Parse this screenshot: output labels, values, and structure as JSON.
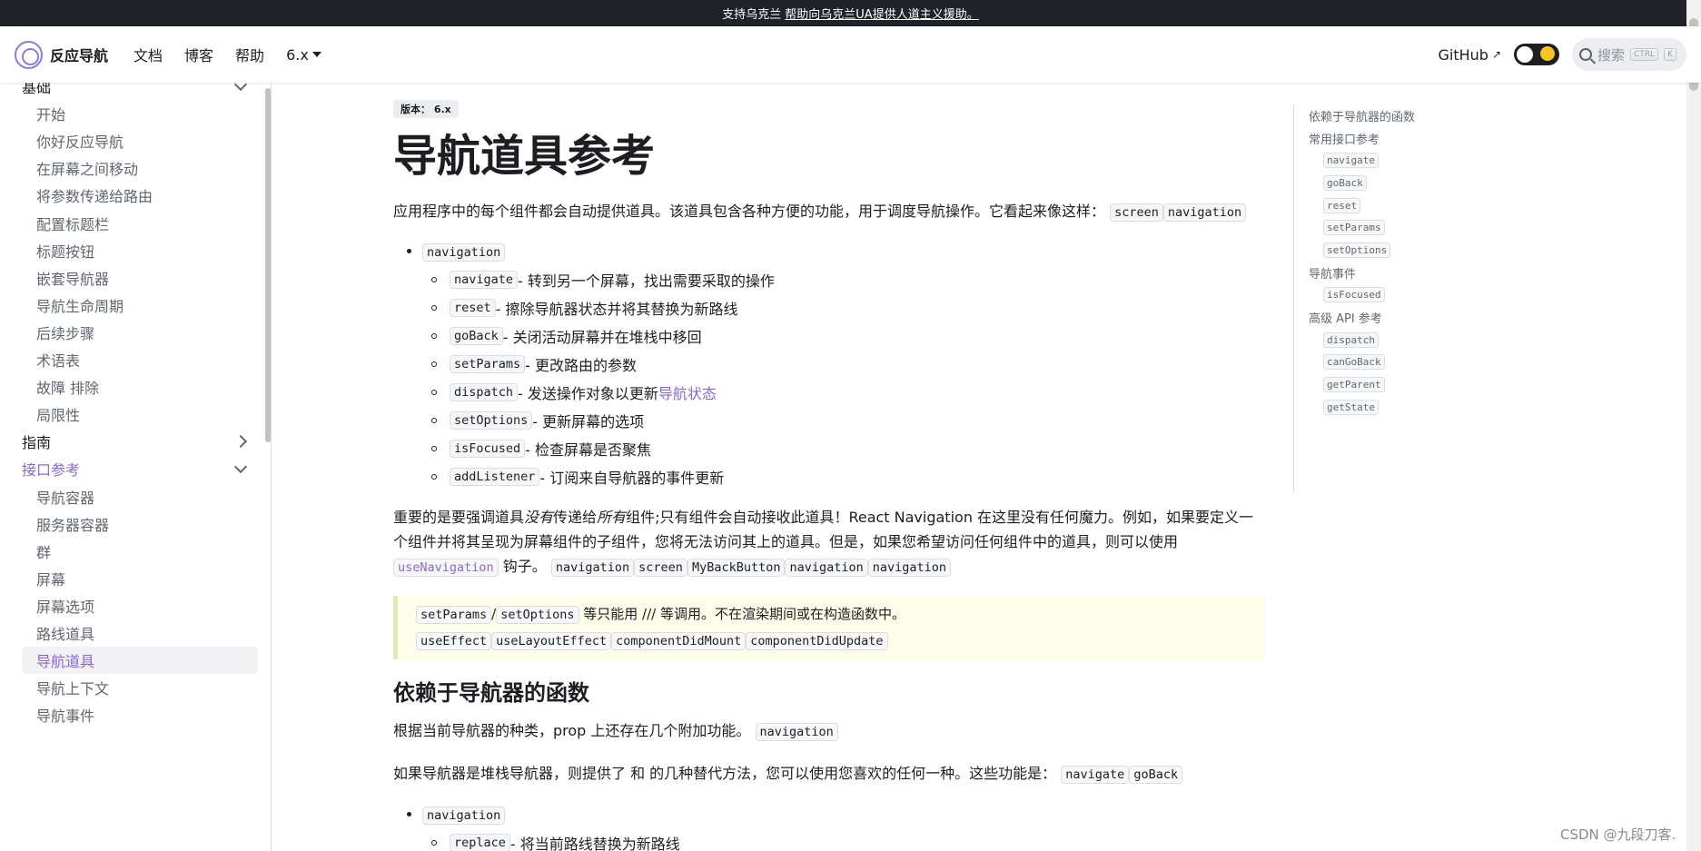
{
  "banner": {
    "prefix": "支持乌克兰",
    "link": "帮助向乌克兰UA提供人道主义援助。"
  },
  "navbar": {
    "brand": "反应导航",
    "links": [
      "文档",
      "博客",
      "帮助"
    ],
    "version": "6.x",
    "github": "GitHub",
    "search_placeholder": "搜索",
    "keys": [
      "CTRL",
      "K"
    ]
  },
  "sidebar": {
    "items": [
      {
        "label": "基础",
        "kind": "cat",
        "open": true
      },
      {
        "label": "开始",
        "kind": "child"
      },
      {
        "label": "你好反应导航",
        "kind": "child"
      },
      {
        "label": "在屏幕之间移动",
        "kind": "child"
      },
      {
        "label": "将参数传递给路由",
        "kind": "child"
      },
      {
        "label": "配置标题栏",
        "kind": "child"
      },
      {
        "label": "标题按钮",
        "kind": "child"
      },
      {
        "label": "嵌套导航器",
        "kind": "child"
      },
      {
        "label": "导航生命周期",
        "kind": "child"
      },
      {
        "label": "后续步骤",
        "kind": "child"
      },
      {
        "label": "术语表",
        "kind": "child"
      },
      {
        "label": "故障 排除",
        "kind": "child"
      },
      {
        "label": "局限性",
        "kind": "child"
      },
      {
        "label": "指南",
        "kind": "cat",
        "open": false
      },
      {
        "label": "接口参考",
        "kind": "cat",
        "open": true,
        "active": true
      },
      {
        "label": "导航容器",
        "kind": "child"
      },
      {
        "label": "服务器容器",
        "kind": "child"
      },
      {
        "label": "群",
        "kind": "child"
      },
      {
        "label": "屏幕",
        "kind": "child"
      },
      {
        "label": "屏幕选项",
        "kind": "child"
      },
      {
        "label": "路线道具",
        "kind": "child"
      },
      {
        "label": "导航道具",
        "kind": "child",
        "selected": true
      },
      {
        "label": "导航上下文",
        "kind": "child"
      },
      {
        "label": "导航事件",
        "kind": "child"
      }
    ]
  },
  "main": {
    "badge": "版本： 6.x",
    "title": "导航道具参考",
    "intro": "应用程序中的每个组件都会自动提供道具。该道具包含各种方便的功能，用于调度导航操作。它看起来像这样：",
    "intro_codes": [
      "screen",
      "navigation"
    ],
    "list_head": "navigation",
    "list": [
      {
        "code": "navigate",
        "text": "- 转到另一个屏幕，找出需要采取的操作"
      },
      {
        "code": "reset",
        "text": "- 擦除导航器状态并将其替换为新路线"
      },
      {
        "code": "goBack",
        "text": "- 关闭活动屏幕并在堆栈中移回"
      },
      {
        "code": "setParams",
        "text": "- 更改路由的参数"
      },
      {
        "code": "dispatch",
        "text": "- 发送操作对象以更新",
        "link": "导航状态"
      },
      {
        "code": "setOptions",
        "text": "- 更新屏幕的选项"
      },
      {
        "code": "isFocused",
        "text": "- 检查屏幕是否聚焦"
      },
      {
        "code": "addListener",
        "text": "- 订阅来自导航器的事件更新"
      }
    ],
    "para2_a": "重要的是要强调道具",
    "para2_em1": "没有",
    "para2_b": "传递给",
    "para2_em2": "所有",
    "para2_c": "组件;只有组件会自动接收此道具！React Navigation 在这里没有任何魔力。例如，如果要定义一个组件并将其呈现为屏幕组件的子组件，您将无法访问其上的道具。但是，如果您希望访问任何组件中的道具，则可以使用",
    "para2_link": "useNavigation",
    "para2_d": "钩子。",
    "para2_codes": [
      "navigation",
      "screen",
      "MyBackButton",
      "navigation",
      "navigation"
    ],
    "note_line1_codes": [
      "setParams",
      "setOptions"
    ],
    "note_line1_sep": "/",
    "note_line1_text": "等只能用 /// 等调用。不在渲染期间或在构造函数中。",
    "note_line2_codes": [
      "useEffect",
      "useLayoutEffect",
      "componentDidMount",
      "componentDidUpdate"
    ],
    "h2": "依赖于导航器的函数",
    "para3": "根据当前导航器的种类，prop 上还存在几个附加功能。",
    "para3_code": "navigation",
    "para4": "如果导航器是堆栈导航器，则提供了 和 的几种替代方法，您可以使用您喜欢的任何一种。这些功能是：",
    "para4_codes": [
      "navigate",
      "goBack"
    ],
    "list2_head": "navigation",
    "list2": [
      {
        "code": "replace",
        "text": "- 将当前路线替换为新路线"
      }
    ]
  },
  "toc": [
    {
      "label": "依赖于导航器的函数",
      "sub": false
    },
    {
      "label": "常用接口参考",
      "sub": false
    },
    {
      "label": "navigate",
      "sub": true
    },
    {
      "label": "goBack",
      "sub": true
    },
    {
      "label": "reset",
      "sub": true
    },
    {
      "label": "setParams",
      "sub": true
    },
    {
      "label": "setOptions",
      "sub": true
    },
    {
      "label": "导航事件",
      "sub": false
    },
    {
      "label": "isFocused",
      "sub": true
    },
    {
      "label": "高级 API 参考",
      "sub": false
    },
    {
      "label": "dispatch",
      "sub": true
    },
    {
      "label": "canGoBack",
      "sub": true
    },
    {
      "label": "getParent",
      "sub": true
    },
    {
      "label": "getState",
      "sub": true
    }
  ],
  "watermark": "CSDN @九段刀客."
}
